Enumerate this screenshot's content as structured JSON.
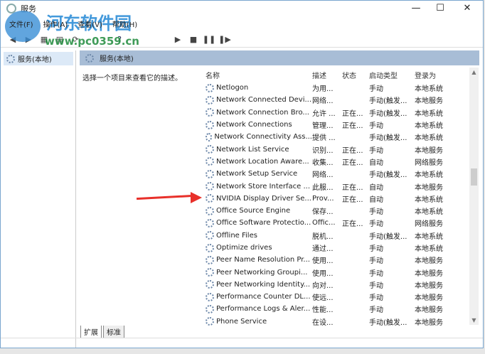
{
  "window": {
    "title": "服务",
    "controls": [
      "—",
      "☐",
      "✕"
    ]
  },
  "menu": [
    "文件(F)",
    "操作(A)",
    "查看(V)",
    "帮助(H)"
  ],
  "watermark": {
    "name": "河东软件园",
    "url": "www.pc0359.cn"
  },
  "left_tree": {
    "item": "服务(本地)"
  },
  "right": {
    "band_title": "服务(本地)",
    "description": "选择一个项目来查看它的描述。"
  },
  "columns": [
    "名称",
    "描述",
    "状态",
    "启动类型",
    "登录为"
  ],
  "rows": [
    [
      "Netlogon",
      "为用...",
      "",
      "手动",
      "本地系统"
    ],
    [
      "Network Connected Devi...",
      "网络...",
      "",
      "手动(触发...",
      "本地服务"
    ],
    [
      "Network Connection Bro...",
      "允许 ...",
      "正在...",
      "手动(触发...",
      "本地系统"
    ],
    [
      "Network Connections",
      "管理...",
      "正在...",
      "手动",
      "本地系统"
    ],
    [
      "Network Connectivity Ass...",
      "提供 ...",
      "",
      "手动(触发...",
      "本地系统"
    ],
    [
      "Network List Service",
      "识别...",
      "正在...",
      "手动",
      "本地服务"
    ],
    [
      "Network Location Aware...",
      "收集...",
      "正在...",
      "自动",
      "网络服务"
    ],
    [
      "Network Setup Service",
      "网络...",
      "",
      "手动(触发...",
      "本地系统"
    ],
    [
      "Network Store Interface ...",
      "此服...",
      "正在...",
      "自动",
      "本地服务"
    ],
    [
      "NVIDIA Display Driver Se...",
      "Prov...",
      "正在...",
      "自动",
      "本地系统"
    ],
    [
      "Office  Source Engine",
      "保存...",
      "",
      "手动",
      "本地系统"
    ],
    [
      "Office Software Protectio...",
      "Offic...",
      "正在...",
      "手动",
      "网络服务"
    ],
    [
      "Offline Files",
      "脱机...",
      "",
      "手动(触发...",
      "本地系统"
    ],
    [
      "Optimize drives",
      "通过...",
      "",
      "手动",
      "本地系统"
    ],
    [
      "Peer Name Resolution Pr...",
      "使用...",
      "",
      "手动",
      "本地服务"
    ],
    [
      "Peer Networking Groupi...",
      "使用...",
      "",
      "手动",
      "本地服务"
    ],
    [
      "Peer Networking Identity...",
      "向对...",
      "",
      "手动",
      "本地服务"
    ],
    [
      "Performance Counter DL...",
      "使远...",
      "",
      "手动",
      "本地服务"
    ],
    [
      "Performance Logs & Aler...",
      "性能...",
      "",
      "手动",
      "本地服务"
    ],
    [
      "Phone Service",
      "在设...",
      "",
      "手动(触发...",
      "本地服务"
    ]
  ],
  "tabs": [
    "扩展",
    "标准"
  ]
}
